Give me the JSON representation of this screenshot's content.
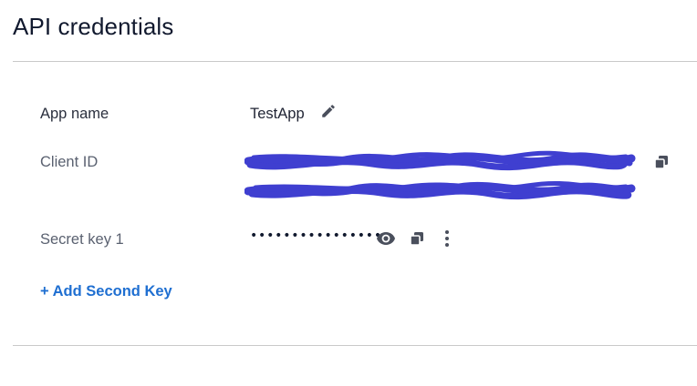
{
  "page": {
    "title": "API credentials"
  },
  "credentials": {
    "app_name": {
      "label": "App name",
      "value": "TestApp",
      "edit_icon": "pencil-icon"
    },
    "client_id": {
      "label": "Client ID",
      "value_state": "redacted",
      "copy_icon": "copy-icon"
    },
    "secret_key": {
      "label": "Secret key 1",
      "masked_value": "•••••••••••••••••",
      "reveal_icon": "eye-icon",
      "copy_icon": "copy-icon",
      "menu_icon": "kebab-menu-icon"
    }
  },
  "actions": {
    "add_second_key": "+ Add Second Key"
  },
  "colors": {
    "link": "#1f6fd1",
    "redaction_scribble": "#3f3fd0",
    "divider": "#c9c9c9",
    "label_text": "#5a6170",
    "title_text": "#11192e"
  }
}
